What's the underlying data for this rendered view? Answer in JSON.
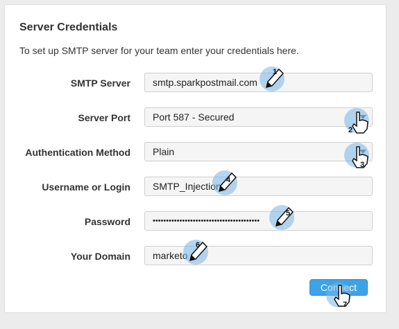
{
  "panel": {
    "title": "Server Credentials",
    "description": "To set up SMTP server for your team enter your credentials here."
  },
  "form": {
    "smtp_server": {
      "label": "SMTP Server",
      "value": "smtp.sparkpostmail.com"
    },
    "server_port": {
      "label": "Server Port",
      "value": "Port 587 - Secured"
    },
    "auth_method": {
      "label": "Authentication Method",
      "value": "Plain"
    },
    "username": {
      "label": "Username or Login",
      "value": "SMTP_Injection"
    },
    "password": {
      "label": "Password",
      "value": "••••••••••••••••••••••••••••••••••••••••"
    },
    "domain": {
      "label": "Your Domain",
      "value": "marketo"
    }
  },
  "actions": {
    "connect_label": "Connect"
  },
  "steps": [
    "1",
    "2",
    "3",
    "4",
    "5",
    "6",
    "7"
  ],
  "colors": {
    "accent": "#3da3e6",
    "annotation_glow": "#78b4e6"
  }
}
